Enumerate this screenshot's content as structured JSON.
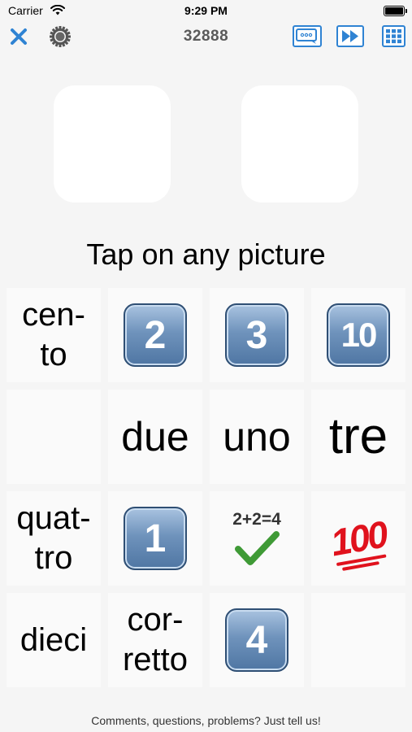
{
  "status_bar": {
    "carrier": "Carrier",
    "time": "9:29 PM"
  },
  "toolbar": {
    "score": "32888",
    "icons": [
      "close-icon",
      "settings-gear-icon",
      "chat-bubble-icon",
      "fast-forward-icon",
      "grid-icon"
    ],
    "accent_color": "#2f83d3"
  },
  "prompt": "Tap on any picture",
  "tiles": [
    {
      "kind": "word",
      "lines": [
        "cen-",
        "to"
      ]
    },
    {
      "kind": "keycap",
      "label": "2"
    },
    {
      "kind": "keycap",
      "label": "3"
    },
    {
      "kind": "keycap",
      "label": "10"
    },
    {
      "kind": "empty"
    },
    {
      "kind": "word",
      "text": "due"
    },
    {
      "kind": "word",
      "text": "uno"
    },
    {
      "kind": "word",
      "text": "tre"
    },
    {
      "kind": "word",
      "lines": [
        "quat-",
        "tro"
      ]
    },
    {
      "kind": "keycap",
      "label": "1"
    },
    {
      "kind": "math",
      "text": "2+2=4",
      "icon": "check-mark-icon"
    },
    {
      "kind": "emoji",
      "text": "100",
      "icon": "hundred-points-icon"
    },
    {
      "kind": "word",
      "text": "dieci"
    },
    {
      "kind": "word",
      "lines": [
        "cor-",
        "retto"
      ]
    },
    {
      "kind": "keycap",
      "label": "4"
    },
    {
      "kind": "empty"
    }
  ],
  "footer": "Comments, questions, problems? Just tell us!"
}
